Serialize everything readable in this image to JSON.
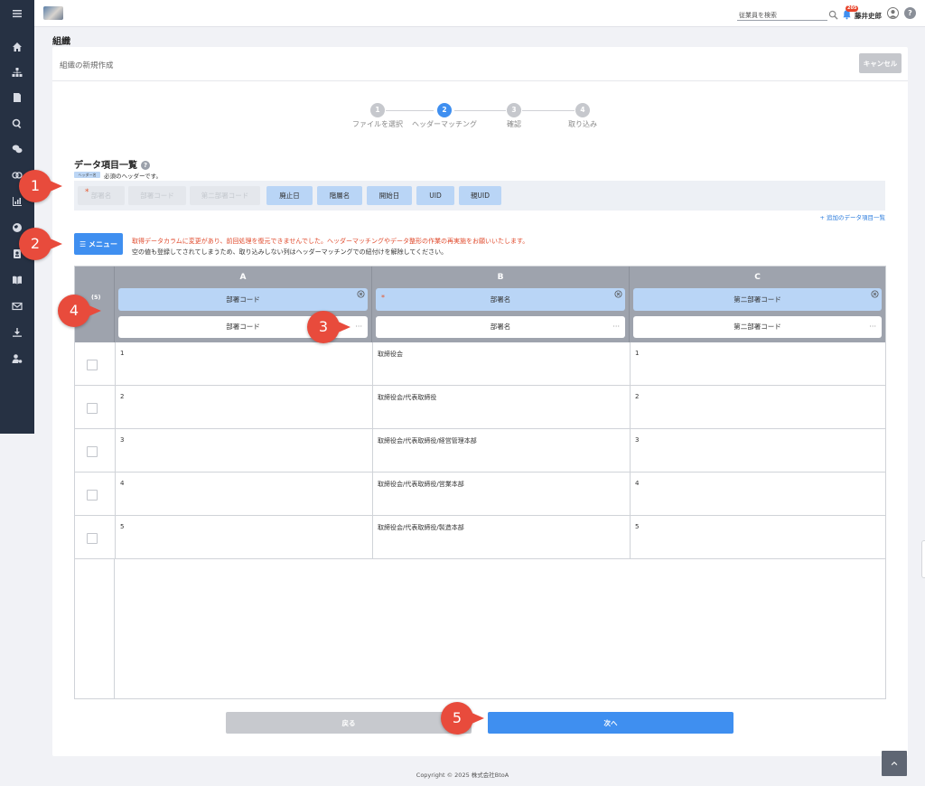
{
  "sidebar": {
    "items": [
      "menu-icon",
      "home-icon",
      "org-icon",
      "document-icon",
      "search-icon",
      "chat-icon",
      "hands-icon",
      "chart-icon",
      "globe-icon",
      "id-card-icon",
      "book-icon",
      "mail-icon",
      "download-icon",
      "user-settings-icon"
    ]
  },
  "topbar": {
    "search_placeholder": "従業員を検索",
    "badge": "205",
    "user_name": "藤井史郎",
    "help": "?"
  },
  "page": {
    "title": "組織"
  },
  "card": {
    "title": "組織の新規作成",
    "cancel": "キャンセル"
  },
  "stepper": [
    {
      "num": "1",
      "label": "ファイルを選択"
    },
    {
      "num": "2",
      "label": "ヘッダーマッチング"
    },
    {
      "num": "3",
      "label": "確認"
    },
    {
      "num": "4",
      "label": "取り込み"
    }
  ],
  "data_items": {
    "title": "データ項目一覧",
    "legend_pill": "ヘッダー名",
    "legend_text": "必須のヘッダーです。",
    "headers": [
      "部署名",
      "部署コード",
      "第二部署コード",
      "廃止日",
      "階層名",
      "開始日",
      "UID",
      "親UID"
    ],
    "add_link": "+ 追加のデータ項目一覧"
  },
  "menu": {
    "label": "☰ メニュー"
  },
  "messages": {
    "warning": "取得データカラムに変更があり、前回処理を復元できませんでした。ヘッダーマッチングやデータ整形の作業の再実施をお願いいたします。",
    "note": "空の値も登録してされてしまうため、取り込みしない列はヘッダーマッチングでの紐付けを解除してください。"
  },
  "table": {
    "corner": "(5)",
    "columns": [
      {
        "letter": "A",
        "header": "部署コード",
        "select": "部署コード"
      },
      {
        "letter": "B",
        "header": "部署名",
        "select": "部署名"
      },
      {
        "letter": "C",
        "header": "第二部署コード",
        "select": "第二部署コード"
      }
    ],
    "rows": [
      [
        "1",
        "取締役会",
        "1"
      ],
      [
        "2",
        "取締役会/代表取締役",
        "2"
      ],
      [
        "3",
        "取締役会/代表取締役/経営管理本部",
        "3"
      ],
      [
        "4",
        "取締役会/代表取締役/営業本部",
        "4"
      ],
      [
        "5",
        "取締役会/代表取締役/製造本部",
        "5"
      ]
    ]
  },
  "buttons": {
    "back": "戻る",
    "next": "次へ"
  },
  "footer": {
    "copyright": "Copyright © 2025 株式会社BtoA"
  },
  "callouts": [
    "1",
    "2",
    "3",
    "4",
    "5"
  ]
}
